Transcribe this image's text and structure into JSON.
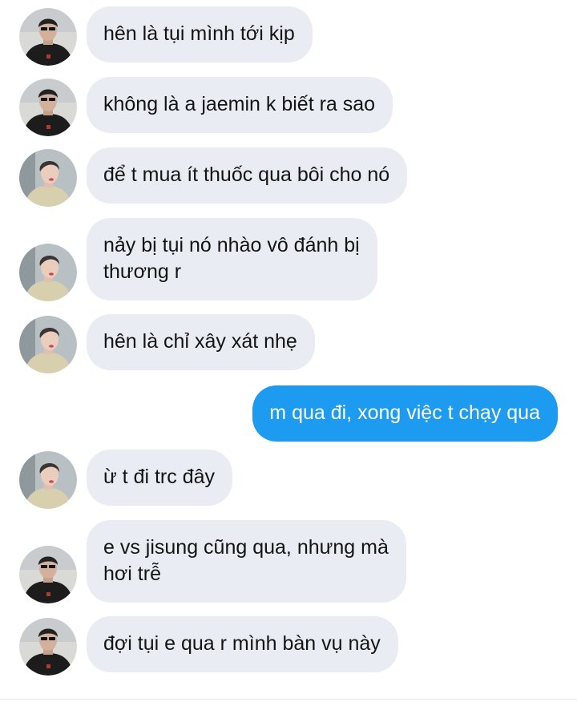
{
  "conversation": {
    "messages": [
      {
        "text": "hên là tụi mình tới kịp",
        "avatar": "avatar-dark-shirt"
      },
      {
        "text": "không là a jaemin k biết ra sao",
        "avatar": "avatar-dark-shirt"
      },
      {
        "text": "để t mua ít thuốc qua bôi cho nó",
        "avatar": "avatar-light-shirt"
      },
      {
        "text": "nảy bị tụi nó nhào vô đánh bị\nthương r",
        "avatar": "avatar-light-shirt"
      },
      {
        "text": "hên là chỉ xây xát nhẹ",
        "avatar": "avatar-light-shirt"
      },
      {
        "text": "m qua đi, xong việc t chạy qua",
        "outgoing": true
      },
      {
        "text": "ừ t đi trc đây",
        "avatar": "avatar-light-shirt"
      },
      {
        "text": "e vs jisung cũng qua, nhưng mà\nhơi trễ",
        "avatar": "avatar-dark-shirt"
      },
      {
        "text": "đợi tụi e qua r mình bàn vụ này",
        "avatar": "avatar-dark-shirt"
      }
    ]
  },
  "colors": {
    "incoming_bubble": "#e9ecf2",
    "outgoing_bubble": "#1d9bf0",
    "text": "#141414"
  }
}
